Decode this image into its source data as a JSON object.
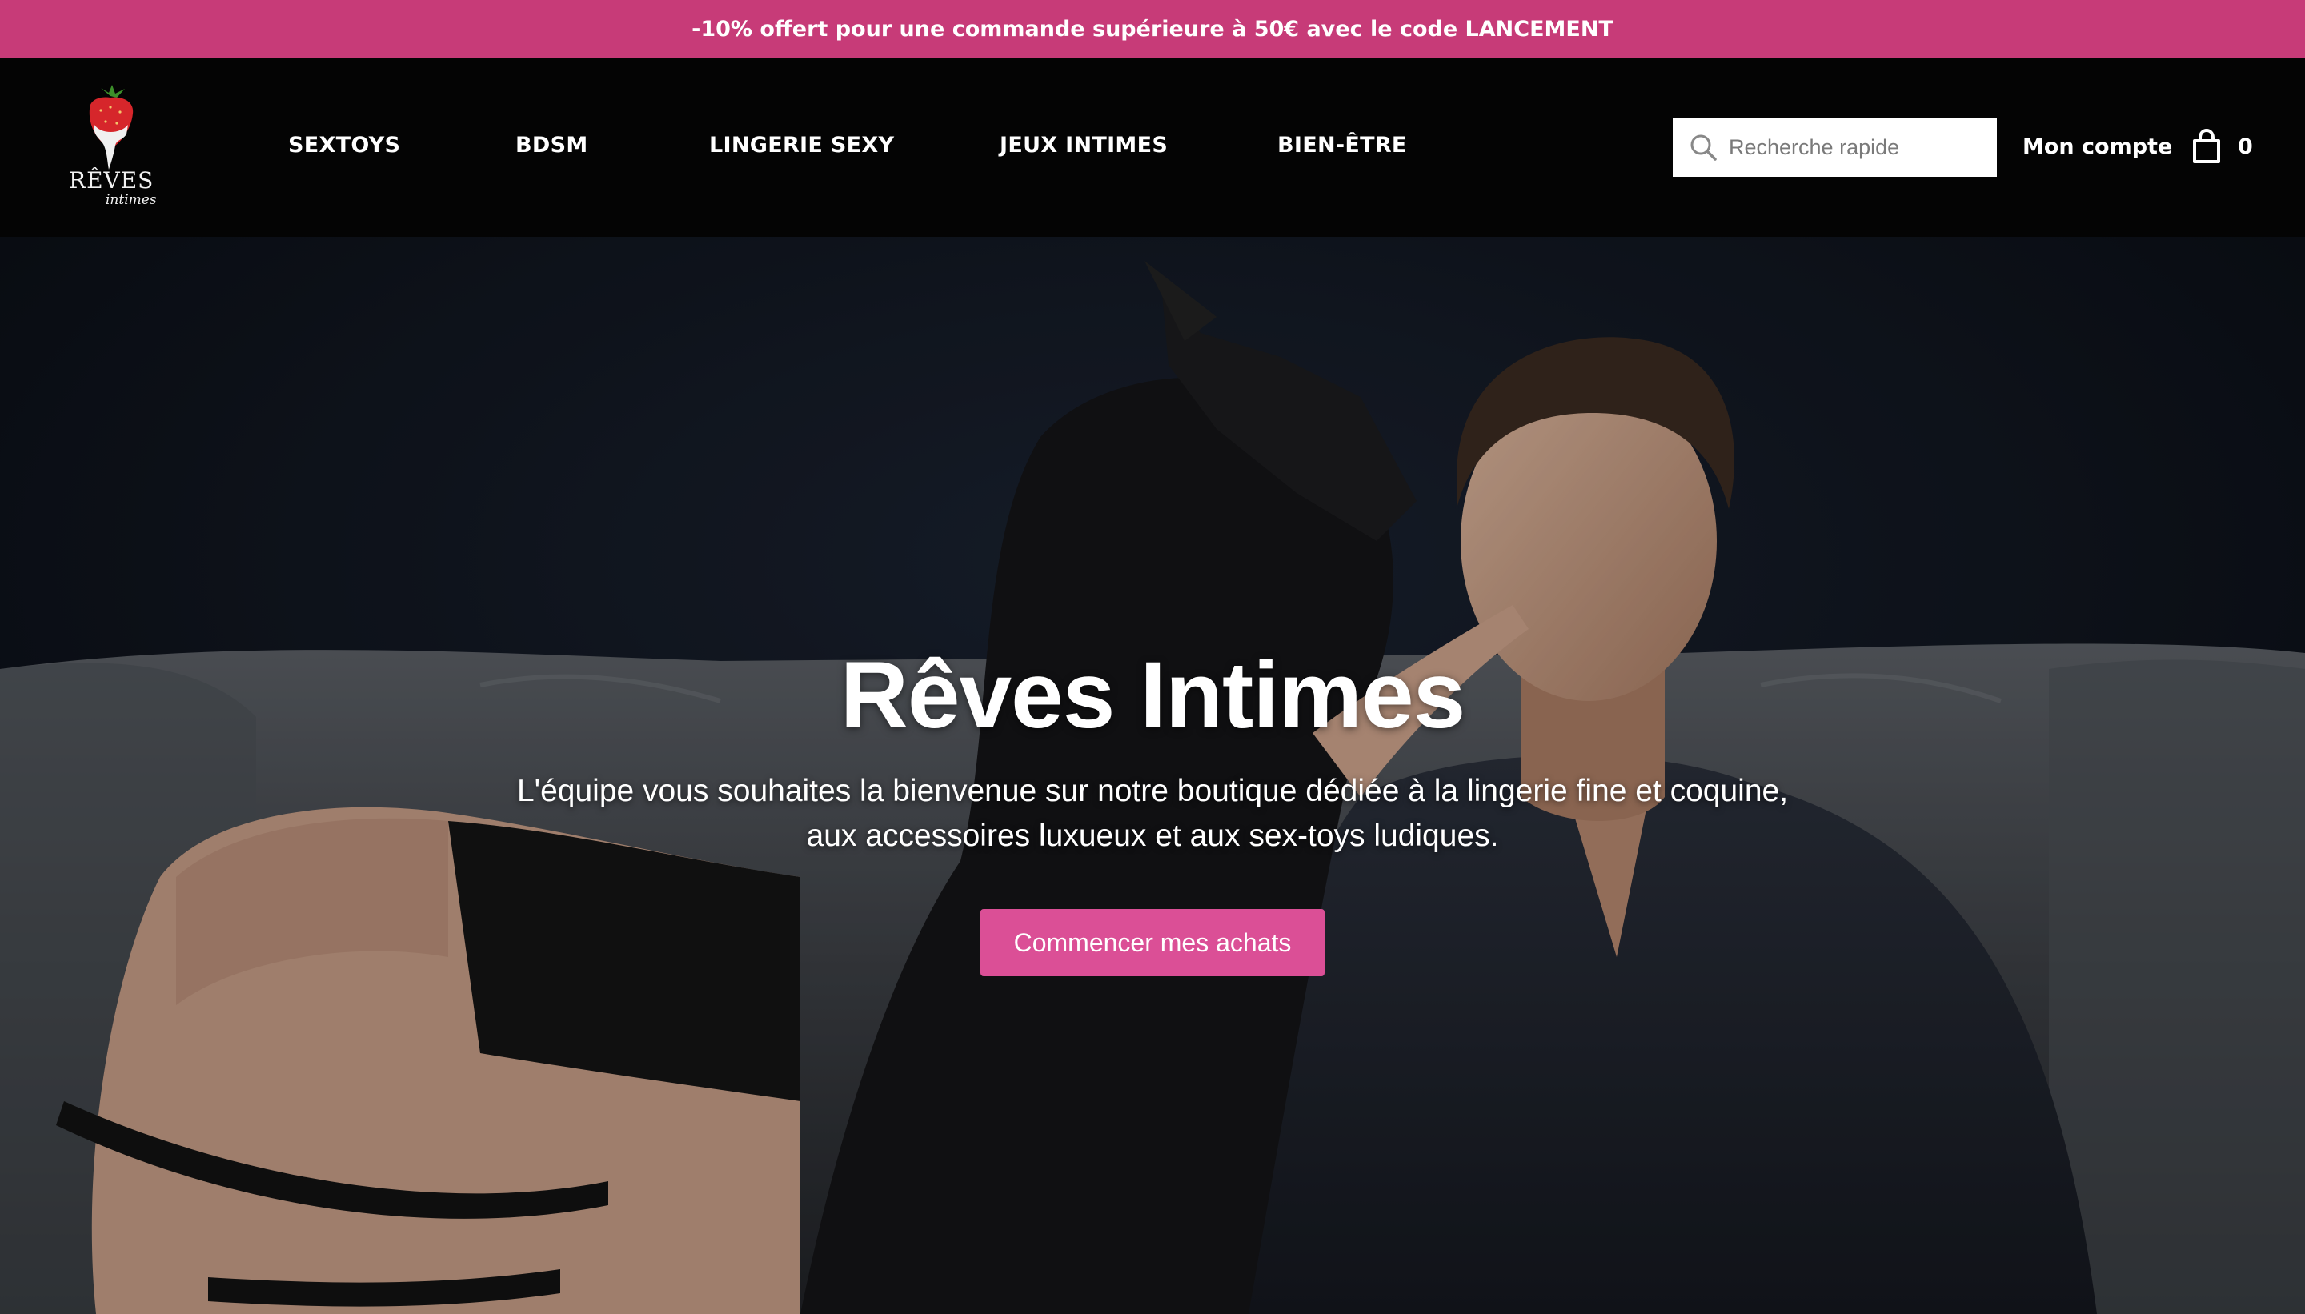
{
  "promo": {
    "text": "-10% offert pour une commande supérieure à 50€ avec le code LANCEMENT"
  },
  "logo": {
    "word": "RÊVES",
    "sub": "intimes",
    "icon": "strawberry-icon"
  },
  "nav": {
    "items": [
      {
        "label": "SEXTOYS"
      },
      {
        "label": "BDSM"
      },
      {
        "label": "LINGERIE SEXY"
      },
      {
        "label": "JEUX INTIMES"
      },
      {
        "label": "BIEN-ÊTRE"
      }
    ]
  },
  "search": {
    "placeholder": "Recherche rapide",
    "icon": "search-icon"
  },
  "account": {
    "label": "Mon compte"
  },
  "cart": {
    "icon": "shopping-bag-icon",
    "count": "0"
  },
  "hero": {
    "title": "Rêves Intimes",
    "subtitle": "L'équipe vous souhaites la bienvenue sur notre boutique dédiée à la lingerie fine et coquine, aux accessoires luxueux et aux sex-toys ludiques.",
    "cta_label": "Commencer mes achats"
  },
  "colors": {
    "promo_bg": "#c73b78",
    "header_bg": "#040404",
    "cta_bg": "#db4f96"
  }
}
